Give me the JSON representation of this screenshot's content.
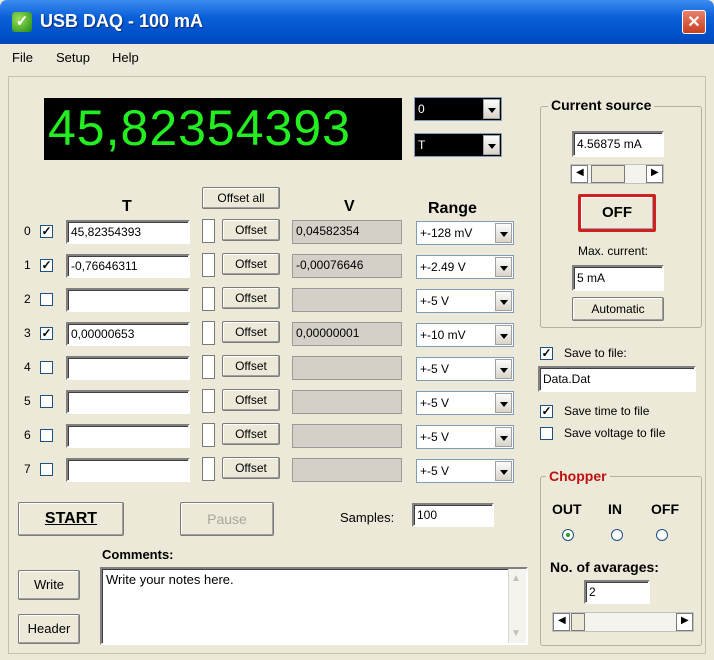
{
  "window": {
    "title": "USB DAQ - 100 mA",
    "close_glyph": "✕",
    "app_icon": "leaf-icon"
  },
  "menu": [
    "File",
    "Setup",
    "Help"
  ],
  "display": {
    "value": "45,82354393",
    "channel_select": "0",
    "quantity_select": "T"
  },
  "headers": {
    "t": "T",
    "offset_all": "Offset all",
    "v": "V",
    "range": "Range"
  },
  "channels": [
    {
      "id": "0",
      "checked": true,
      "t": "45,82354393",
      "offset": "Offset",
      "v": "0,04582354",
      "range": "+-128 mV"
    },
    {
      "id": "1",
      "checked": true,
      "t": "-0,76646311",
      "offset": "Offset",
      "v": "-0,00076646",
      "range": "+-2.49 V"
    },
    {
      "id": "2",
      "checked": false,
      "t": "",
      "offset": "Offset",
      "v": "",
      "range": "+-5 V"
    },
    {
      "id": "3",
      "checked": true,
      "t": "0,00000653",
      "offset": "Offset",
      "v": "0,00000001",
      "range": "+-10 mV"
    },
    {
      "id": "4",
      "checked": false,
      "t": "",
      "offset": "Offset",
      "v": "",
      "range": "+-5 V"
    },
    {
      "id": "5",
      "checked": false,
      "t": "",
      "offset": "Offset",
      "v": "",
      "range": "+-5 V"
    },
    {
      "id": "6",
      "checked": false,
      "t": "",
      "offset": "Offset",
      "v": "",
      "range": "+-5 V"
    },
    {
      "id": "7",
      "checked": false,
      "t": "",
      "offset": "Offset",
      "v": "",
      "range": "+-5 V"
    }
  ],
  "controls": {
    "start": "START",
    "pause": "Pause",
    "samples_label": "Samples:",
    "samples_value": "100"
  },
  "comments": {
    "label": "Comments:",
    "write": "Write",
    "header": "Header",
    "text": "Write your notes here."
  },
  "current_source": {
    "title": "Current source",
    "value": "4.56875 mA",
    "off_button": "OFF",
    "max_label": "Max. current:",
    "max_value": "5 mA",
    "automatic": "Automatic",
    "off_border": "#d02020"
  },
  "save": {
    "save_to_file": "Save to file:",
    "save_to_file_checked": true,
    "filename": "Data.Dat",
    "save_time": "Save time to file",
    "save_time_checked": true,
    "save_voltage": "Save voltage to file",
    "save_voltage_checked": false
  },
  "chopper": {
    "title": "Chopper",
    "title_color": "#c01010",
    "options": [
      "OUT",
      "IN",
      "OFF"
    ],
    "selected": "OUT",
    "avg_label": "No. of avarages:",
    "avg_value": "2"
  }
}
